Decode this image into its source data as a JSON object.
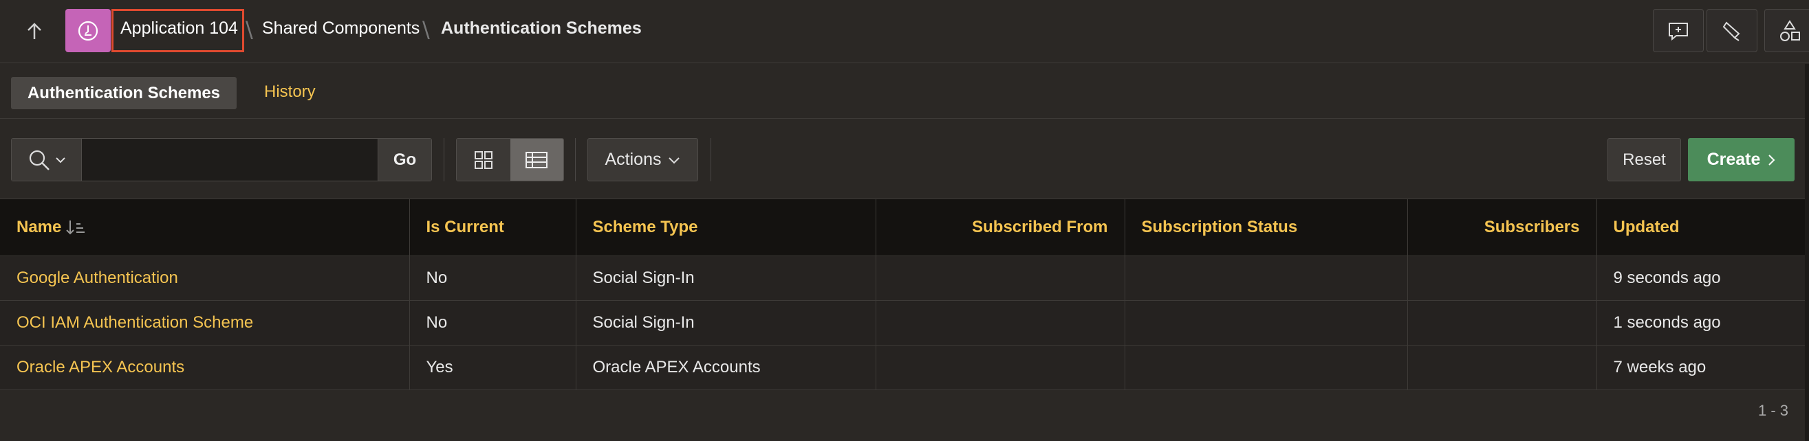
{
  "breadcrumb": {
    "app": "Application 104",
    "shared": "Shared Components",
    "current": "Authentication Schemes"
  },
  "tabs": [
    {
      "label": "Authentication Schemes",
      "active": true
    },
    {
      "label": "History",
      "active": false
    }
  ],
  "toolbar": {
    "search_value": "",
    "go_label": "Go",
    "actions_label": "Actions",
    "reset_label": "Reset",
    "create_label": "Create"
  },
  "table": {
    "columns": [
      "Name",
      "Is Current",
      "Scheme Type",
      "Subscribed From",
      "Subscription Status",
      "Subscribers",
      "Updated"
    ],
    "rows": [
      [
        "Google Authentication",
        "No",
        "Social Sign-In",
        "",
        "",
        "",
        "9 seconds ago"
      ],
      [
        "OCI IAM Authentication Scheme",
        "No",
        "Social Sign-In",
        "",
        "",
        "",
        "1 seconds ago"
      ],
      [
        "Oracle APEX Accounts",
        "Yes",
        "Oracle APEX Accounts",
        "",
        "",
        "",
        "7 weeks ago"
      ]
    ]
  },
  "pagination": "1 - 3",
  "colors": {
    "accent": "#f5c451",
    "app_icon": "#c564b7",
    "create": "#4c8c5a",
    "highlight": "#e04a2f"
  }
}
